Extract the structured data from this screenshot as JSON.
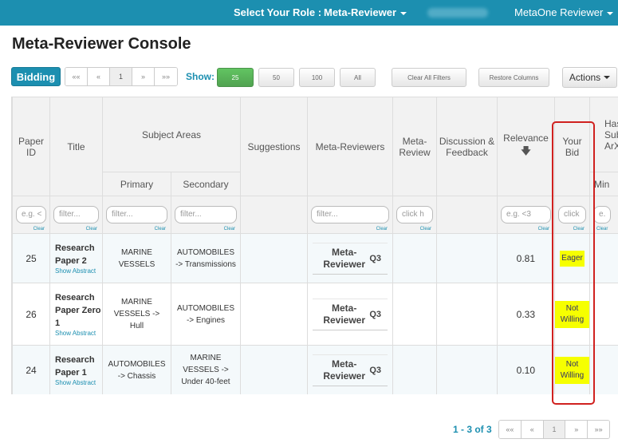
{
  "topbar": {
    "role_label": "Select Your Role :",
    "role_value": "Meta-Reviewer",
    "user_name": "MetaOne Reviewer"
  },
  "page_title": "Meta-Reviewer Console",
  "toolbar": {
    "bidding_label": "Bidding",
    "pager": [
      "««",
      "«",
      "1",
      "»",
      "»»"
    ],
    "show_label": "Show:",
    "show_options": [
      "25",
      "50",
      "100",
      "All"
    ],
    "clear_filters": "Clear All Filters",
    "restore_columns": "Restore Columns",
    "actions": "Actions"
  },
  "table": {
    "headers": {
      "paper_id": "Paper ID",
      "title": "Title",
      "subject_areas": "Subject Areas",
      "primary": "Primary",
      "secondary": "Secondary",
      "suggestions": "Suggestions",
      "meta_reviewers": "Meta-Reviewers",
      "meta_review": "Meta-Review",
      "discussion": "Discussion & Feedback",
      "relevance": "Relevance",
      "relevance_sort": "🡇",
      "your_bid": "Your Bid",
      "has_submission": "Has Submission ArXiv",
      "min": "Min"
    },
    "filters": {
      "paper_id": "e.g. <",
      "title": "filter...",
      "primary": "filter...",
      "secondary": "filter...",
      "meta_reviewers": "filter...",
      "meta_review": "click h",
      "relevance": "e.g. <3",
      "your_bid": "click",
      "has_submission": "e.",
      "clear": "Clear"
    },
    "show_abstract": "Show Abstract",
    "rows": [
      {
        "id": "25",
        "title": "Research Paper 2",
        "primary": "MARINE VESSELS",
        "secondary": "AUTOMOBILES -> Transmissions",
        "meta_reviewer": "Meta-Reviewer",
        "q": "Q3",
        "relevance": "0.81",
        "bid": "Eager"
      },
      {
        "id": "26",
        "title": "Research Paper Zero 1",
        "primary": "MARINE VESSELS -> Hull",
        "secondary": "AUTOMOBILES -> Engines",
        "meta_reviewer": "Meta-Reviewer",
        "q": "Q3",
        "relevance": "0.33",
        "bid": "Not Willing"
      },
      {
        "id": "24",
        "title": "Research Paper 1",
        "primary": "AUTOMOBILES -> Chassis",
        "secondary": "MARINE VESSELS -> Under 40-feet",
        "meta_reviewer": "Meta-Reviewer",
        "q": "Q3",
        "relevance": "0.10",
        "bid": "Not Willing"
      }
    ]
  },
  "footer": {
    "count": "1 - 3 of 3",
    "pager": [
      "««",
      "«",
      "1",
      "»",
      "»»"
    ]
  },
  "colors": {
    "brand": "#1c8fb0",
    "highlight": "#f6ff00",
    "annotation": "#d0211f"
  }
}
